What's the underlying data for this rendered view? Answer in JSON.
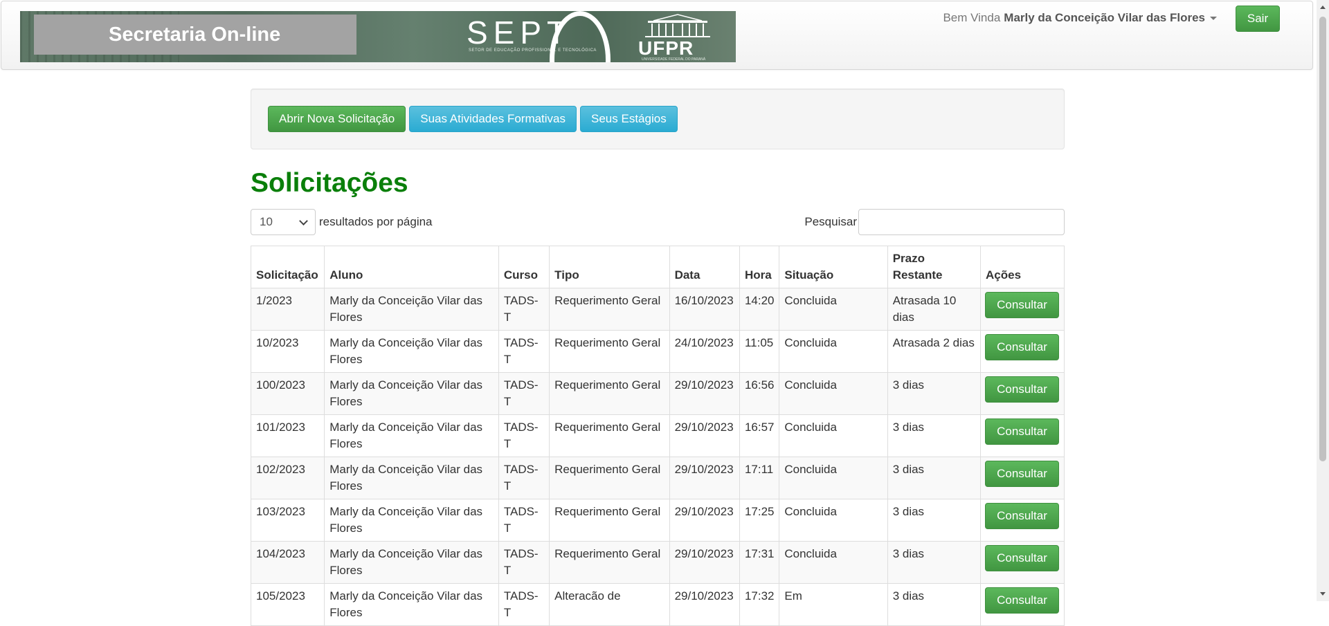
{
  "header": {
    "banner_title": "Secretaria On-line",
    "banner_sept": "SEPT",
    "banner_sept_sub": "SETOR DE EDUCAÇÃO PROFISSIONAL E TECNOLÓGICA",
    "banner_ufpr": "UFPR",
    "banner_ufpr_sub": "UNIVERSIDADE FEDERAL DO PARANÁ",
    "welcome_prefix": "Bem Vinda",
    "user_name": "Marly da Conceição Vilar das Flores",
    "logout_label": "Sair"
  },
  "actions": {
    "new_request": "Abrir Nova Solicitação",
    "activities": "Suas Atividades Formativas",
    "internships": "Seus Estágios"
  },
  "page_title": "Solicitações",
  "table_controls": {
    "page_length": "10",
    "page_length_suffix": "resultados por página",
    "search_label": "Pesquisar",
    "search_value": ""
  },
  "table": {
    "columns": [
      "Solicitação",
      "Aluno",
      "Curso",
      "Tipo",
      "Data",
      "Hora",
      "Situação",
      "Prazo Restante",
      "Ações"
    ],
    "rows": [
      {
        "id": "1/2023",
        "student": "Marly da Conceição Vilar das Flores",
        "course": "TADS-T",
        "type": "Requerimento Geral",
        "date": "16/10/2023",
        "time": "14:20",
        "status": "Concluida",
        "deadline": "Atrasada 10 dias",
        "action": "Consultar"
      },
      {
        "id": "10/2023",
        "student": "Marly da Conceição Vilar das Flores",
        "course": "TADS-T",
        "type": "Requerimento Geral",
        "date": "24/10/2023",
        "time": "11:05",
        "status": "Concluida",
        "deadline": "Atrasada 2 dias",
        "action": "Consultar"
      },
      {
        "id": "100/2023",
        "student": "Marly da Conceição Vilar das Flores",
        "course": "TADS-T",
        "type": "Requerimento Geral",
        "date": "29/10/2023",
        "time": "16:56",
        "status": "Concluida",
        "deadline": "3 dias",
        "action": "Consultar"
      },
      {
        "id": "101/2023",
        "student": "Marly da Conceição Vilar das Flores",
        "course": "TADS-T",
        "type": "Requerimento Geral",
        "date": "29/10/2023",
        "time": "16:57",
        "status": "Concluida",
        "deadline": "3 dias",
        "action": "Consultar"
      },
      {
        "id": "102/2023",
        "student": "Marly da Conceição Vilar das Flores",
        "course": "TADS-T",
        "type": "Requerimento Geral",
        "date": "29/10/2023",
        "time": "17:11",
        "status": "Concluida",
        "deadline": "3 dias",
        "action": "Consultar"
      },
      {
        "id": "103/2023",
        "student": "Marly da Conceição Vilar das Flores",
        "course": "TADS-T",
        "type": "Requerimento Geral",
        "date": "29/10/2023",
        "time": "17:25",
        "status": "Concluida",
        "deadline": "3 dias",
        "action": "Consultar"
      },
      {
        "id": "104/2023",
        "student": "Marly da Conceição Vilar das Flores",
        "course": "TADS-T",
        "type": "Requerimento Geral",
        "date": "29/10/2023",
        "time": "17:31",
        "status": "Concluida",
        "deadline": "3 dias",
        "action": "Consultar"
      },
      {
        "id": "105/2023",
        "student": "Marly da Conceição Vilar das Flores",
        "course": "TADS-T",
        "type": "Alteracão de",
        "date": "29/10/2023",
        "time": "17:32",
        "status": "Em",
        "deadline": "3 dias",
        "action": "Consultar"
      }
    ]
  },
  "colors": {
    "title_green": "#0a7f0a",
    "success": "#5cb85c",
    "info": "#5bc0de"
  }
}
